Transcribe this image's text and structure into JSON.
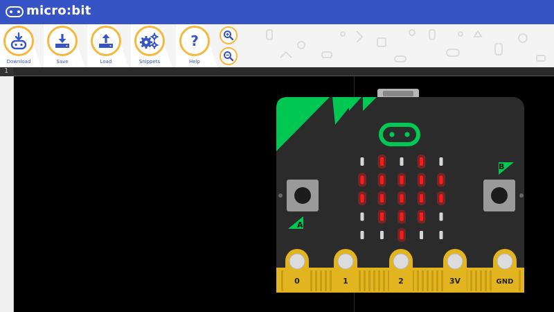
{
  "app": {
    "title": "micro:bit"
  },
  "toolbar": {
    "buttons": [
      {
        "id": "download",
        "label": "Download",
        "icon": "usb-download-icon"
      },
      {
        "id": "save",
        "label": "Save",
        "icon": "save-icon"
      },
      {
        "id": "load",
        "label": "Load",
        "icon": "upload-icon"
      },
      {
        "id": "snippets",
        "label": "Snippets",
        "icon": "gears-icon"
      },
      {
        "id": "help",
        "label": "Help",
        "icon": "help-icon"
      }
    ],
    "zoom_in": "zoom-in-icon",
    "zoom_out": "zoom-out-icon",
    "pattern_text": "0 ◊ □ ⊂ ○ 1 ◇ 0 △ □ ⊂ 1 ○ ◊ 0"
  },
  "editor": {
    "line_number": "1"
  },
  "simulator": {
    "button_a_label": "A",
    "button_b_label": "B",
    "pins": [
      "0",
      "1",
      "2",
      "3V",
      "GND"
    ],
    "led_matrix": [
      [
        0,
        1,
        0,
        1,
        0
      ],
      [
        1,
        1,
        1,
        1,
        1
      ],
      [
        1,
        1,
        1,
        1,
        1
      ],
      [
        0,
        1,
        1,
        1,
        0
      ],
      [
        0,
        0,
        1,
        0,
        0
      ]
    ],
    "colors": {
      "board": "#2b2b2b",
      "accent": "#00c853",
      "led_on": "#ff1a1a",
      "led_off": "#d6d6d6",
      "gold": "#e2b420"
    }
  },
  "colors": {
    "titlebar": "#3754c7",
    "toolbar_ring": "#f5b83d"
  }
}
